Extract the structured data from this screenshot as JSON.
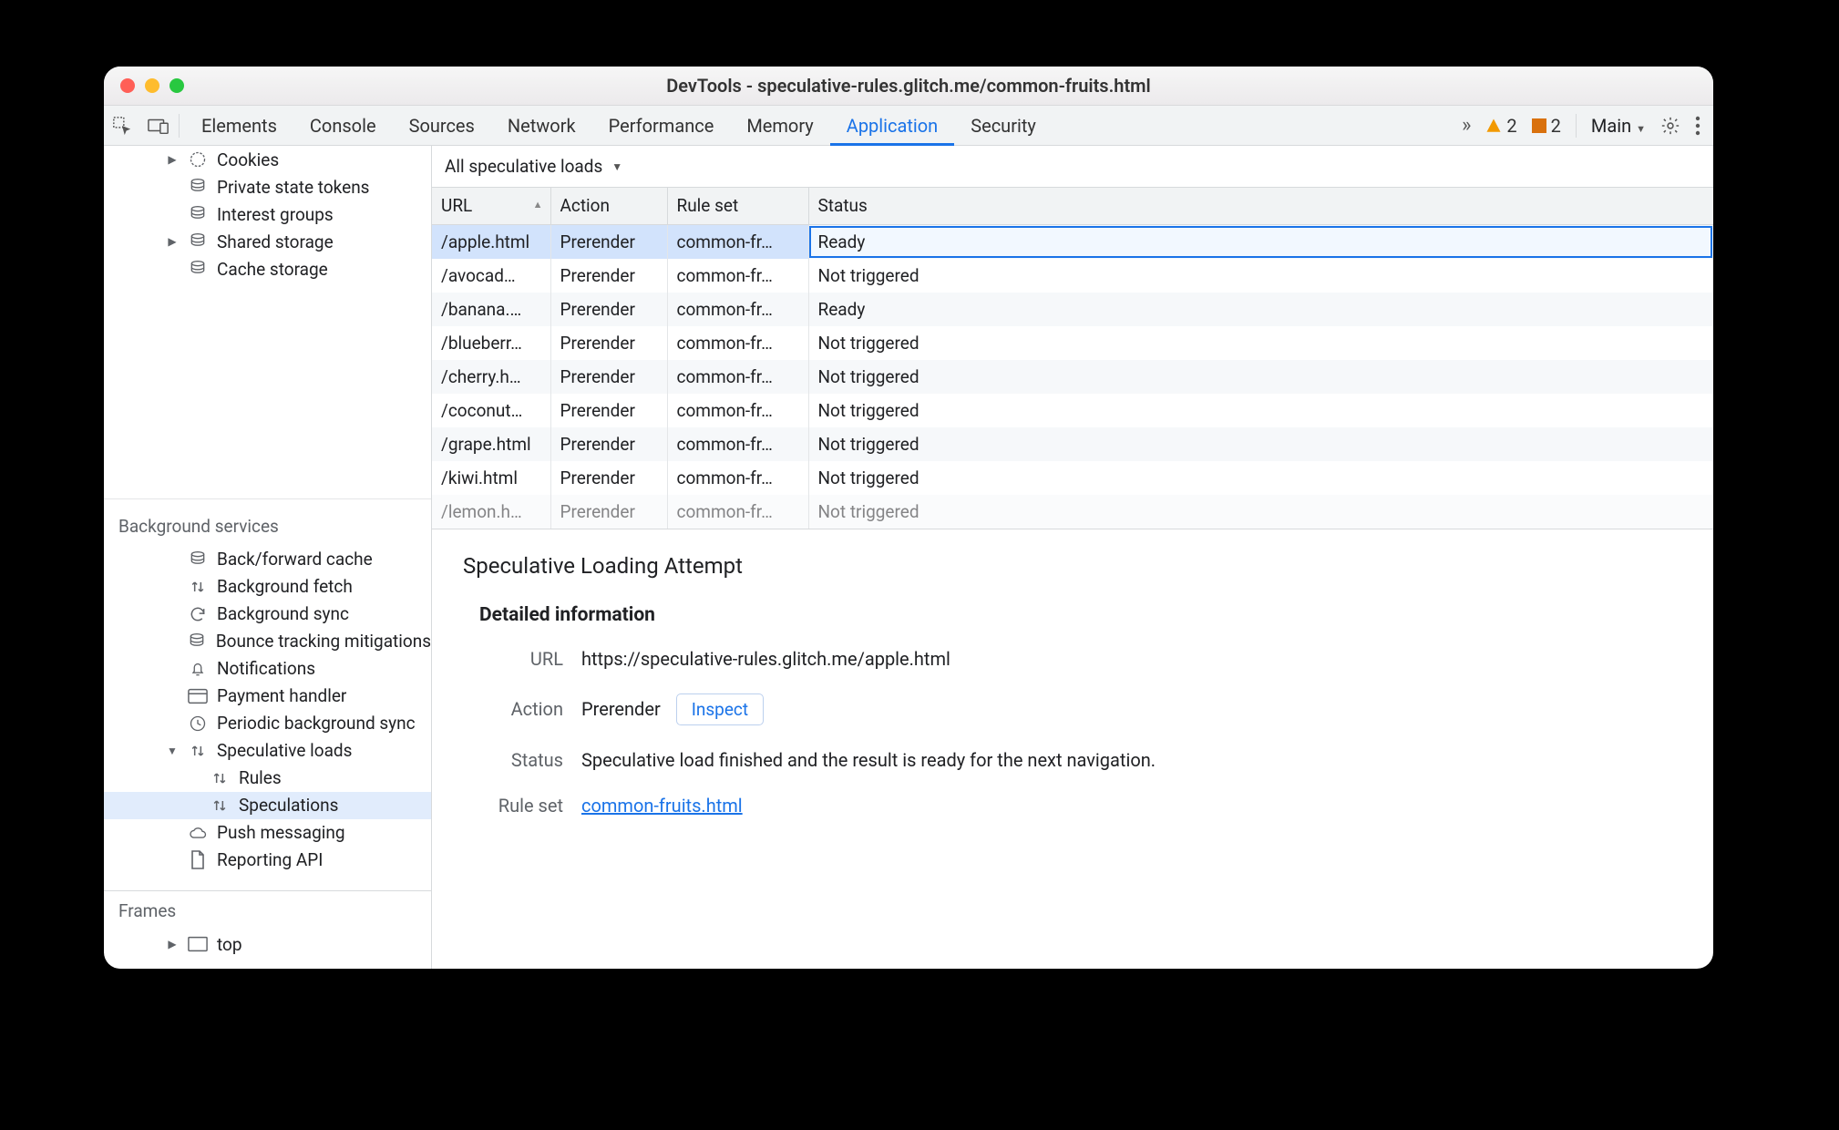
{
  "window": {
    "title": "DevTools - speculative-rules.glitch.me/common-fruits.html"
  },
  "tabs": {
    "items": [
      "Elements",
      "Console",
      "Sources",
      "Network",
      "Performance",
      "Memory",
      "Application",
      "Security"
    ],
    "active": "Application",
    "overflow_count": "»"
  },
  "toolbar_right": {
    "warning_count": "2",
    "info_count": "2",
    "context_label": "Main"
  },
  "sidebar": {
    "storage_items": [
      {
        "label": "Cookies",
        "icon": "cookie",
        "expandable": true,
        "indent": 2
      },
      {
        "label": "Private state tokens",
        "icon": "db",
        "indent": 2
      },
      {
        "label": "Interest groups",
        "icon": "db",
        "indent": 2
      },
      {
        "label": "Shared storage",
        "icon": "db",
        "expandable": true,
        "indent": 2
      },
      {
        "label": "Cache storage",
        "icon": "db",
        "indent": 2
      }
    ],
    "bg_section_label": "Background services",
    "bg_items": [
      {
        "label": "Back/forward cache",
        "icon": "db"
      },
      {
        "label": "Background fetch",
        "icon": "updown"
      },
      {
        "label": "Background sync",
        "icon": "sync"
      },
      {
        "label": "Bounce tracking mitigations",
        "icon": "db"
      },
      {
        "label": "Notifications",
        "icon": "bell"
      },
      {
        "label": "Payment handler",
        "icon": "card"
      },
      {
        "label": "Periodic background sync",
        "icon": "clock"
      },
      {
        "label": "Speculative loads",
        "icon": "updown",
        "expandable": true,
        "expanded": true
      },
      {
        "label": "Rules",
        "icon": "updown",
        "indent": 3
      },
      {
        "label": "Speculations",
        "icon": "updown",
        "indent": 3,
        "selected": true
      },
      {
        "label": "Push messaging",
        "icon": "cloud"
      },
      {
        "label": "Reporting API",
        "icon": "doc"
      }
    ],
    "frames_label": "Frames",
    "frames_item": {
      "label": "top",
      "icon": "frame",
      "expandable": true
    }
  },
  "filterbar": {
    "label": "All speculative loads"
  },
  "table": {
    "headers": {
      "url": "URL",
      "action": "Action",
      "ruleset": "Rule set",
      "status": "Status"
    },
    "rows": [
      {
        "url": "/apple.html",
        "action": "Prerender",
        "ruleset": "common-fr…",
        "status": "Ready",
        "selected": true,
        "focused": true
      },
      {
        "url": "/avocad…",
        "action": "Prerender",
        "ruleset": "common-fr…",
        "status": "Not triggered"
      },
      {
        "url": "/banana.…",
        "action": "Prerender",
        "ruleset": "common-fr…",
        "status": "Ready"
      },
      {
        "url": "/blueberr…",
        "action": "Prerender",
        "ruleset": "common-fr…",
        "status": "Not triggered"
      },
      {
        "url": "/cherry.h…",
        "action": "Prerender",
        "ruleset": "common-fr…",
        "status": "Not triggered"
      },
      {
        "url": "/coconut…",
        "action": "Prerender",
        "ruleset": "common-fr…",
        "status": "Not triggered"
      },
      {
        "url": "/grape.html",
        "action": "Prerender",
        "ruleset": "common-fr…",
        "status": "Not triggered"
      },
      {
        "url": "/kiwi.html",
        "action": "Prerender",
        "ruleset": "common-fr…",
        "status": "Not triggered"
      },
      {
        "url": "/lemon.h…",
        "action": "Prerender",
        "ruleset": "common-fr…",
        "status": "Not triggered",
        "clipped": true
      }
    ]
  },
  "detail": {
    "heading": "Speculative Loading Attempt",
    "section": "Detailed information",
    "labels": {
      "url": "URL",
      "action": "Action",
      "status": "Status",
      "ruleset": "Rule set"
    },
    "url": "https://speculative-rules.glitch.me/apple.html",
    "action": "Prerender",
    "inspect": "Inspect",
    "status": "Speculative load finished and the result is ready for the next navigation.",
    "ruleset": "common-fruits.html"
  }
}
